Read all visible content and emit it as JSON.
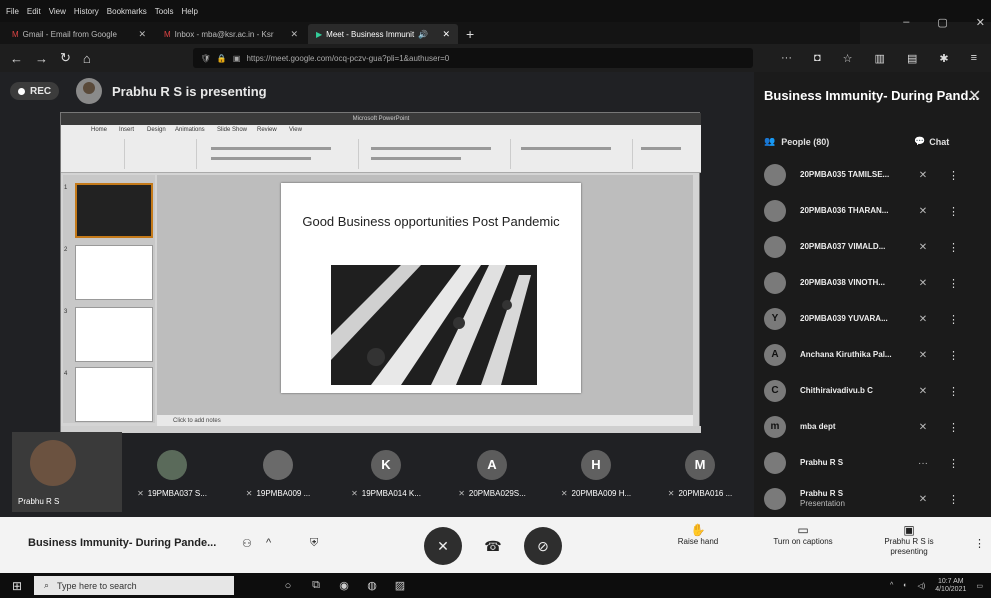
{
  "browser": {
    "menu": [
      "File",
      "Edit",
      "View",
      "History",
      "Bookmarks",
      "Tools",
      "Help"
    ],
    "tabs": [
      {
        "label": "Gmail - Email from Google",
        "active": false
      },
      {
        "label": "Inbox - mba@ksr.ac.in - Ksr",
        "active": false
      },
      {
        "label": "Meet - Business Immunit",
        "active": true
      }
    ],
    "new_tab": "+",
    "url": "https://meet.google.com/ocq-pczv-gua?pli=1&authuser=0",
    "win_controls": [
      "–",
      "▢",
      "✕"
    ]
  },
  "stage": {
    "rec_label": "REC",
    "presenter_label": "Prabhu R S is presenting"
  },
  "ppt": {
    "title_bar": "Microsoft PowerPoint",
    "ribbon_tabs": [
      "Home",
      "Insert",
      "Design",
      "Animations",
      "Slide Show",
      "Review",
      "View"
    ],
    "slide_numbers": [
      "1",
      "2",
      "3",
      "4"
    ],
    "slide_title": "Good Business opportunities Post Pandemic",
    "notes_placeholder": "Click to add notes"
  },
  "self_tile": {
    "label": "Prabhu R S"
  },
  "participant_tiles": [
    {
      "initial": "",
      "label": "19PMBA037 S...",
      "color": "#5a6a5a"
    },
    {
      "initial": "",
      "label": "19PMBA009 ...",
      "color": "#6a6a6a"
    },
    {
      "initial": "K",
      "label": "19PMBA014 K...",
      "color": "#5f5f5f"
    },
    {
      "initial": "A",
      "label": "20PMBA029S...",
      "color": "#5c5c5c"
    },
    {
      "initial": "H",
      "label": "20PMBA009 H...",
      "color": "#606060"
    },
    {
      "initial": "M",
      "label": "20PMBA016 ...",
      "color": "#5d5d5d"
    }
  ],
  "panel": {
    "title": "Business Immunity- During Pand...",
    "people_tab": "People (80)",
    "chat_tab": "Chat",
    "people": [
      {
        "initial": "",
        "name": "20PMBA035 TAMILSE...",
        "status": "mic-off"
      },
      {
        "initial": "",
        "name": "20PMBA036 THARAN...",
        "status": "mic-off"
      },
      {
        "initial": "",
        "name": "20PMBA037 VIMALD...",
        "status": "mic-off"
      },
      {
        "initial": "",
        "name": "20PMBA038 VINOTH...",
        "status": "mic-off"
      },
      {
        "initial": "Y",
        "name": "20PMBA039 YUVARA...",
        "status": "mic-off"
      },
      {
        "initial": "A",
        "name": "Anchana Kiruthika Pal...",
        "status": "mic-off"
      },
      {
        "initial": "C",
        "name": "Chithiraivadivu.b C",
        "status": "mic-off"
      },
      {
        "initial": "m",
        "name": "mba dept",
        "status": "mic-off"
      },
      {
        "initial": "",
        "name": "Prabhu R S",
        "status": "speaking"
      },
      {
        "initial": "",
        "name": "Prabhu R S",
        "sub": "Presentation",
        "status": "mic-off"
      }
    ]
  },
  "controls": {
    "meeting_name": "Business Immunity- During Pande...",
    "raise_hand": "Raise hand",
    "captions": "Turn on captions",
    "presenting": "Prabhu R S is presenting"
  },
  "taskbar": {
    "search_placeholder": "Type here to search",
    "time": "10:7 AM",
    "date": "4/10/2021"
  },
  "colors": {
    "end_call": "#3a3a3a",
    "mic_off": "#2e2e2e",
    "panel_bg": "#1b1b1b"
  }
}
